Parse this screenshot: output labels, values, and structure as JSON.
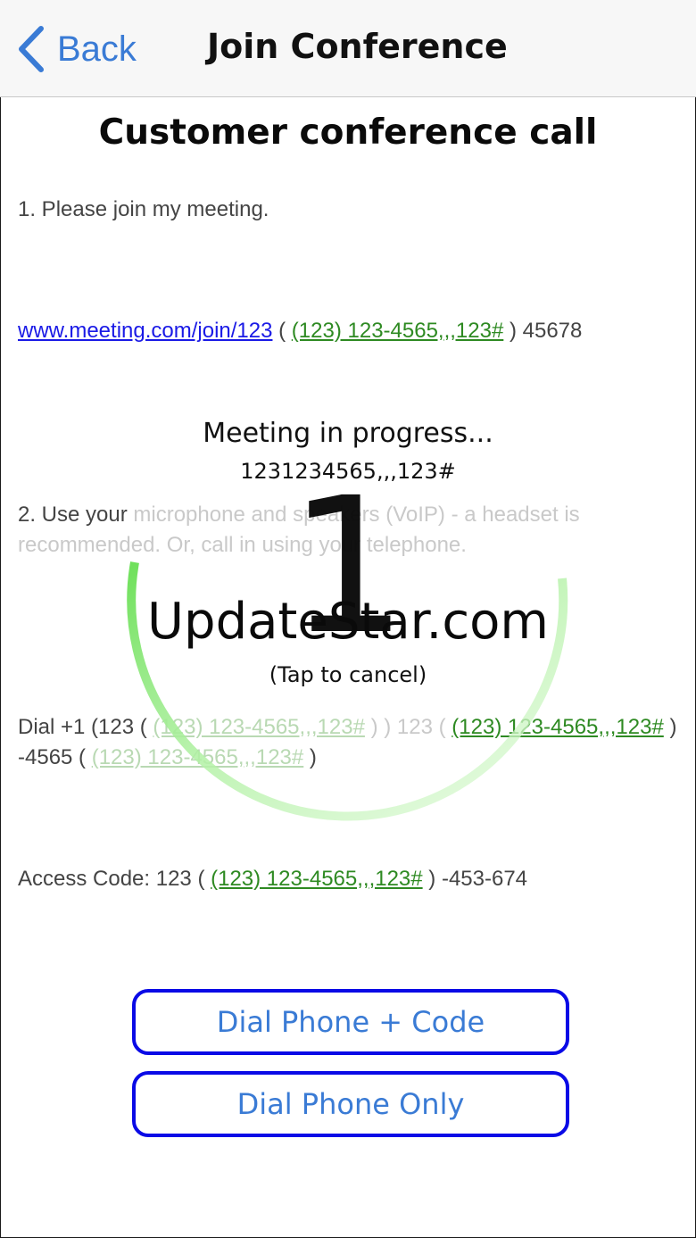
{
  "navbar": {
    "back_label": "Back",
    "back_icon": "chevron-left-icon",
    "title": "Join Conference"
  },
  "page": {
    "title": "Customer conference call",
    "line1": "1. Please join my meeting.",
    "line2": {
      "url": "www.meeting.com/join/123",
      "open_paren": " ( ",
      "phone": "(123) 123-4565,,,123#",
      "close_rest": " ) 45678"
    },
    "line3": {
      "part1": "2. Use your ",
      "part2_faded": "microphone and speakers (VoIP) - a headset is recommended. Or, call in using your telephone.",
      "recommended_prefix": "recommended"
    },
    "line4": {
      "lead": "Dial +1 (123 ( ",
      "phone1": "(123) 123-4565,,,123#",
      "mid1": " ) ) 123 ( ",
      "phone2": "(123) 123-4565,,,123#",
      "mid2": " ) -4565 ( ",
      "phone3": "(123) 123-4565,,,123#",
      "tail": " )"
    },
    "line5": {
      "lead": "Access Code: 123 ( ",
      "phone": "(123) 123-4565,,,123#",
      "tail": " ) -453-674"
    }
  },
  "overlay": {
    "status": "Meeting in progress...",
    "number": "1231234565,,,123#",
    "countdown": "1",
    "watermark": "UpdateStar.com",
    "cancel_hint": "(Tap to cancel)",
    "ring_color": "#7be36a"
  },
  "buttons": {
    "dial_code": "Dial Phone + Code",
    "dial_only": "Dial Phone Only"
  },
  "colors": {
    "accent": "#3a7bd5",
    "link": "#1a1ae6",
    "phone_link": "#2e8a22",
    "button_border": "#0a0ae6"
  }
}
